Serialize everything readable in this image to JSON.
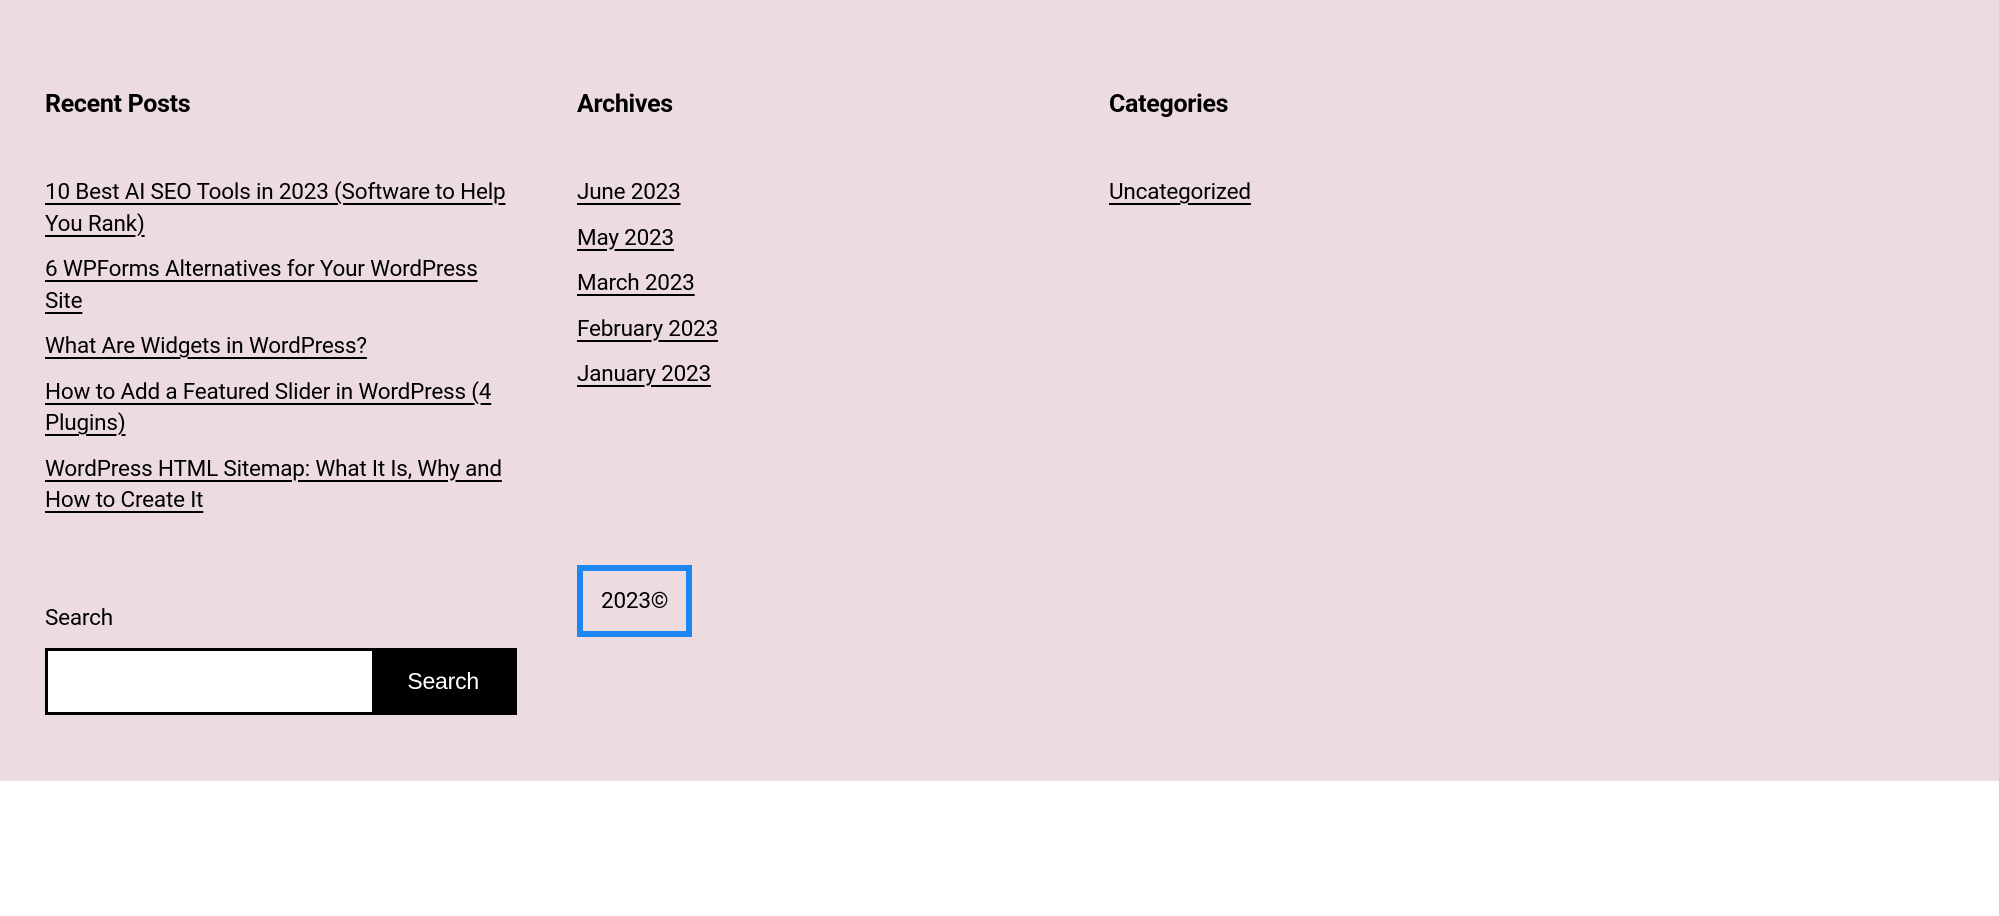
{
  "recentPosts": {
    "title": "Recent Posts",
    "items": [
      "10 Best AI SEO Tools in 2023 (Software to Help You Rank)",
      "6 WPForms Alternatives for Your WordPress Site",
      "What Are Widgets in WordPress?",
      "How to Add a Featured Slider in WordPress (4 Plugins)",
      "WordPress HTML Sitemap: What It Is, Why and How to Create It"
    ]
  },
  "archives": {
    "title": "Archives",
    "items": [
      "June 2023",
      "May 2023",
      "March 2023",
      "February 2023",
      "January 2023"
    ]
  },
  "categories": {
    "title": "Categories",
    "items": [
      "Uncategorized"
    ]
  },
  "search": {
    "label": "Search",
    "button": "Search"
  },
  "copyright": {
    "text": "2023©"
  }
}
